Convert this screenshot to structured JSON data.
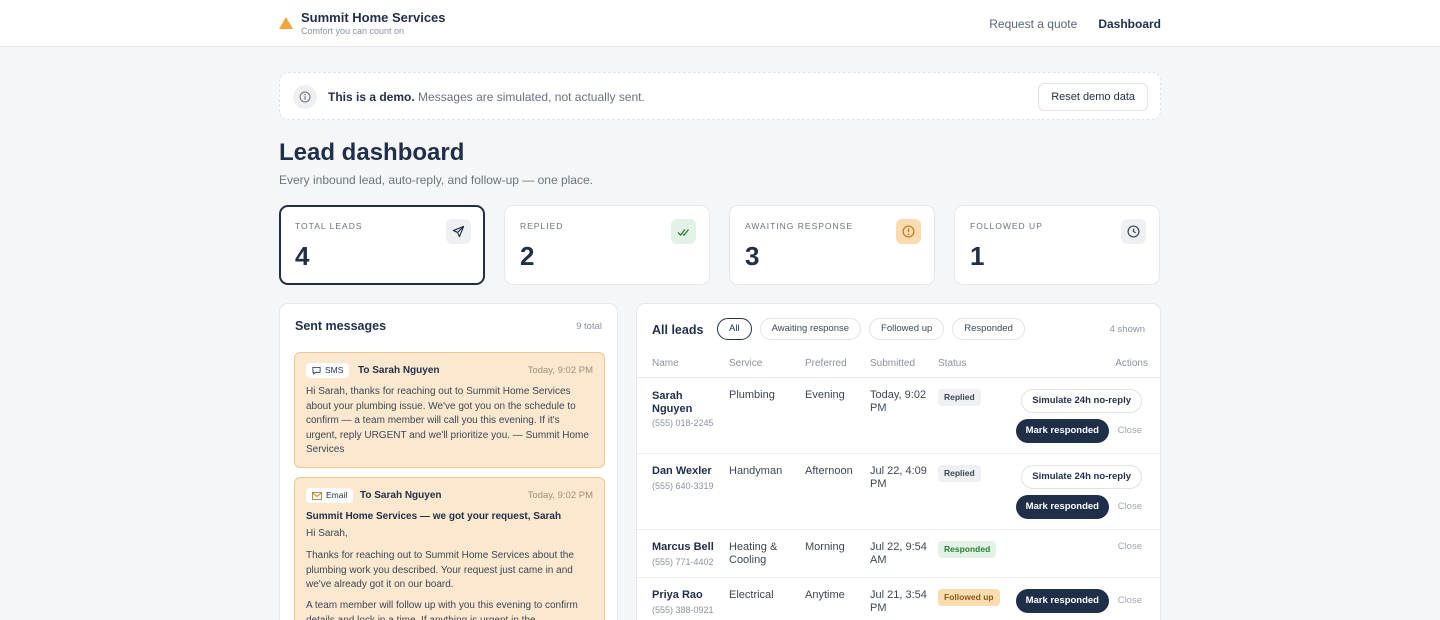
{
  "brand": {
    "name": "Summit Home Services",
    "tagline": "Comfort you can count on"
  },
  "nav": {
    "quote": "Request a quote",
    "dashboard": "Dashboard"
  },
  "demo": {
    "bold": "This is a demo.",
    "text": "Messages are simulated, not actually sent.",
    "reset": "Reset demo data"
  },
  "page": {
    "title": "Lead dashboard",
    "subtitle": "Every inbound lead, auto-reply, and follow-up — one place."
  },
  "stats": [
    {
      "label": "TOTAL LEADS",
      "value": "4",
      "icon": "send-icon"
    },
    {
      "label": "REPLIED",
      "value": "2",
      "icon": "double-check-icon"
    },
    {
      "label": "AWAITING RESPONSE",
      "value": "3",
      "icon": "alert-icon"
    },
    {
      "label": "FOLLOWED UP",
      "value": "1",
      "icon": "clock-icon"
    }
  ],
  "sent": {
    "title": "Sent messages",
    "count": "9 total",
    "messages": [
      {
        "channel": "SMS",
        "to": "To Sarah Nguyen",
        "time": "Today, 9:02 PM",
        "body": "Hi Sarah, thanks for reaching out to Summit Home Services about your plumbing issue. We've got you on the schedule to confirm — a team member will call you this evening. If it's urgent, reply URGENT and we'll prioritize you. — Summit Home Services"
      },
      {
        "channel": "Email",
        "to": "To Sarah Nguyen",
        "time": "Today, 9:02 PM",
        "subject": "Summit Home Services — we got your request, Sarah",
        "p1": "Hi Sarah,",
        "p2": "Thanks for reaching out to Summit Home Services about the plumbing work you described. Your request just came in and we've already got it on our board.",
        "p3": "A team member will follow up with you this evening to confirm details and lock in a time. If anything is urgent in the"
      }
    ]
  },
  "leads": {
    "title": "All leads",
    "shown": "4 shown",
    "filters": [
      "All",
      "Awaiting response",
      "Followed up",
      "Responded"
    ],
    "columns": [
      "Name",
      "Service",
      "Preferred",
      "Submitted",
      "Status",
      "Actions"
    ],
    "actions": {
      "simulate": "Simulate 24h no-reply",
      "mark": "Mark responded",
      "close": "Close"
    },
    "rows": [
      {
        "name": "Sarah Nguyen",
        "phone": "(555) 018-2245",
        "service": "Plumbing",
        "preferred": "Evening",
        "submitted": "Today, 9:02 PM",
        "status": "Replied"
      },
      {
        "name": "Dan Wexler",
        "phone": "(555) 640-3319",
        "service": "Handyman",
        "preferred": "Afternoon",
        "submitted": "Jul 22, 4:09 PM",
        "status": "Replied"
      },
      {
        "name": "Marcus Bell",
        "phone": "(555) 771-4402",
        "service": "Heating & Cooling",
        "preferred": "Morning",
        "submitted": "Jul 22, 9:54 AM",
        "status": "Responded"
      },
      {
        "name": "Priya Rao",
        "phone": "(555) 388-0921",
        "service": "Electrical",
        "preferred": "Anytime",
        "submitted": "Jul 21, 3:54 PM",
        "status": "Followed up"
      }
    ]
  }
}
